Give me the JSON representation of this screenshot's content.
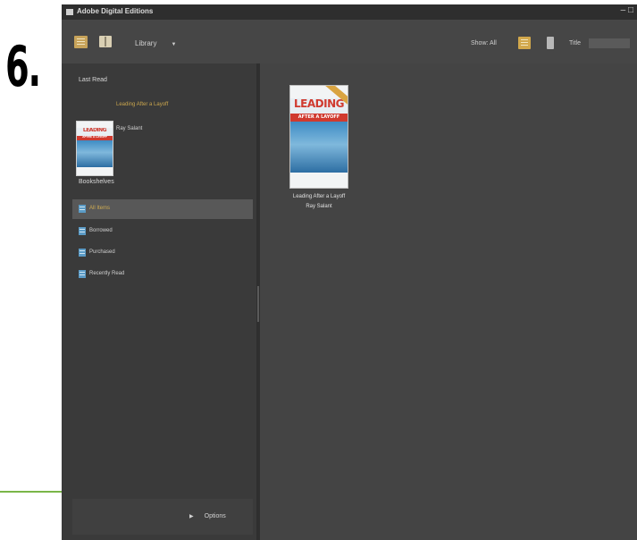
{
  "step": {
    "number": "6."
  },
  "window": {
    "title": "Adobe Digital Editions",
    "controls": "– □"
  },
  "toolbar": {
    "library_label": "Library",
    "dropdown_caret": "▼",
    "show_filter": "Show: All",
    "sort_label": "Title"
  },
  "sidebar": {
    "last_read_heading": "Last Read",
    "last_read_book": {
      "title": "Leading After a Layoff",
      "author": "Ray Salant"
    },
    "bookshelves_heading": "Bookshelves",
    "shelves": [
      {
        "label": "All Items"
      },
      {
        "label": "Borrowed"
      },
      {
        "label": "Purchased"
      },
      {
        "label": "Recently Read"
      }
    ],
    "options_arrow": "▶",
    "options_label": "Options"
  },
  "content": {
    "books": [
      {
        "title": "Leading After a Layoff",
        "author": "Ray Salant",
        "cover": {
          "word1": "LEADING",
          "band": "AFTER A LAYOFF"
        }
      }
    ]
  },
  "colors": {
    "accent": "#c9a54d",
    "window_bg": "#3c3c3c",
    "shelf_icon": "#5b9bc6",
    "green_rule": "#7ab648"
  },
  "icons": {
    "library_view": "library-icon",
    "reading_view": "book-icon",
    "thumbnail_view": "thumbnail-view-icon",
    "list_view": "list-view-icon",
    "shelf": "bookshelf-icon"
  }
}
